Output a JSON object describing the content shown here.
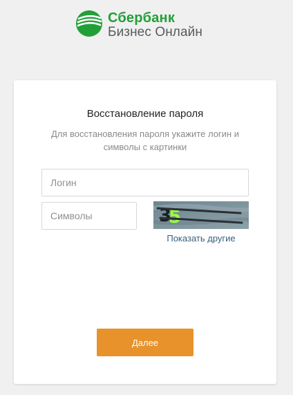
{
  "header": {
    "brand": "Сбербанк",
    "subtitle": "Бизнес Онлайн",
    "logo_icon": "sberbank-logo-icon",
    "brand_color": "#21a038"
  },
  "form": {
    "title": "Восстановление пароля",
    "description": "Для восстановления пароля укажите логин и символы с картинки",
    "login": {
      "placeholder": "Логин",
      "value": ""
    },
    "symbols": {
      "placeholder": "Символы",
      "value": ""
    },
    "captcha": {
      "text": "35"
    },
    "show_other_label": "Показать другие",
    "next_label": "Далее",
    "accent_color": "#e8922b",
    "link_color": "#36607c"
  }
}
